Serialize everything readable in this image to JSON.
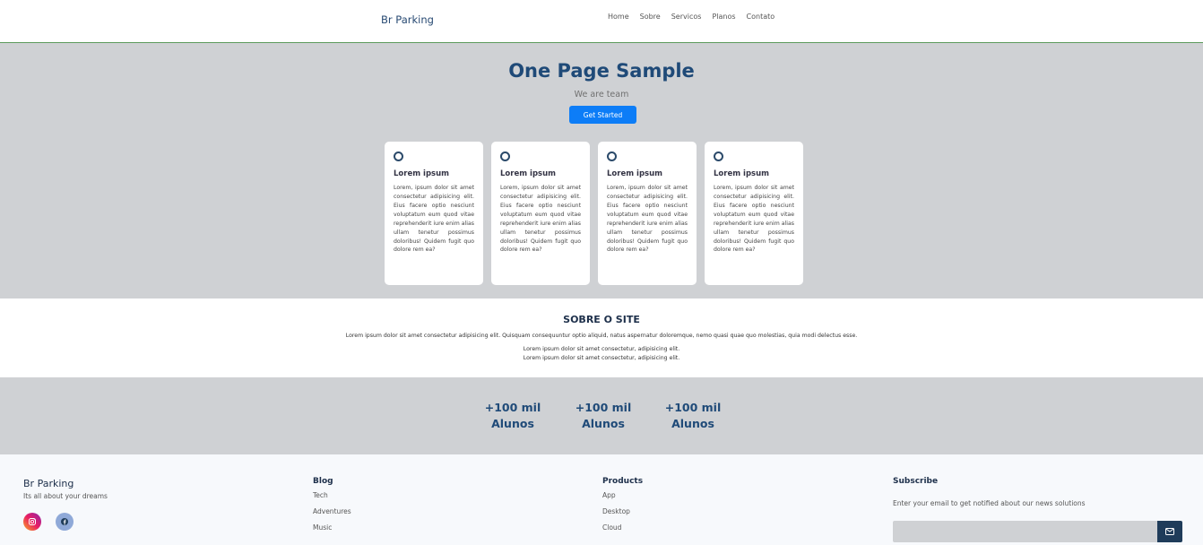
{
  "header": {
    "brand": "Br Parking",
    "nav": [
      "Home",
      "Sobre",
      "Servicos",
      "Planos",
      "Contato"
    ]
  },
  "hero": {
    "title": "One Page Sample",
    "subtitle": "We are team",
    "button": "Get Started",
    "cards": [
      {
        "icon": "circle-icon",
        "title": "Lorem ipsum",
        "text": "Lorem, ipsum dolor sit amet consectetur adipisicing elit. Eius facere optio nesciunt voluptatum eum quod vitae reprehenderit iure enim alias ullam tenetur possimus doloribus! Quidem fugit quo dolore rem ea?"
      },
      {
        "icon": "circle-icon",
        "title": "Lorem ipsum",
        "text": "Lorem, ipsum dolor sit amet consectetur adipisicing elit. Eius facere optio nesciunt voluptatum eum quod vitae reprehenderit iure enim alias ullam tenetur possimus doloribus! Quidem fugit quo dolore rem ea?"
      },
      {
        "icon": "circle-icon",
        "title": "Lorem ipsum",
        "text": "Lorem, ipsum dolor sit amet consectetur adipisicing elit. Eius facere optio nesciunt voluptatum eum quod vitae reprehenderit iure enim alias ullam tenetur possimus doloribus! Quidem fugit quo dolore rem ea?"
      },
      {
        "icon": "circle-icon",
        "title": "Lorem ipsum",
        "text": "Lorem, ipsum dolor sit amet consectetur adipisicing elit. Eius facere optio nesciunt voluptatum eum quod vitae reprehenderit iure enim alias ullam tenetur possimus doloribus! Quidem fugit quo dolore rem ea?"
      }
    ]
  },
  "about": {
    "title": "SOBRE O SITE",
    "p1": "Lorem ipsum dolor sit amet consectetur adipisicing elit. Quisquam consequuntur optio aliquid, natus aspernatur doloremque, nemo quasi quae quo molestias, quia modi delectus esse.",
    "p2": "Lorem ipsum dolor sit amet consectetur, adipisicing elit.",
    "p3": "Lorem ipsum dolor sit amet consectetur, adipisicing elit."
  },
  "stats": [
    {
      "value": "+100 mil",
      "label": "Alunos"
    },
    {
      "value": "+100 mil",
      "label": "Alunos"
    },
    {
      "value": "+100 mil",
      "label": "Alunos"
    }
  ],
  "footer": {
    "brand": "Br Parking",
    "tagline": "Its all about your dreams",
    "social": [
      "instagram-icon",
      "facebook-icon"
    ],
    "blog": {
      "title": "Blog",
      "links": [
        "Tech",
        "Adventures",
        "Music"
      ]
    },
    "products": {
      "title": "Products",
      "links": [
        "App",
        "Desktop",
        "Cloud"
      ]
    },
    "subscribe": {
      "title": "Subscribe",
      "text": "Enter your email to get notified about our news solutions",
      "placeholder": ""
    }
  },
  "colors": {
    "primary": "#1f4a78",
    "button": "#0d7df7",
    "section_gray": "#cfd1d4",
    "subscribe_button": "#1f3c5a"
  }
}
